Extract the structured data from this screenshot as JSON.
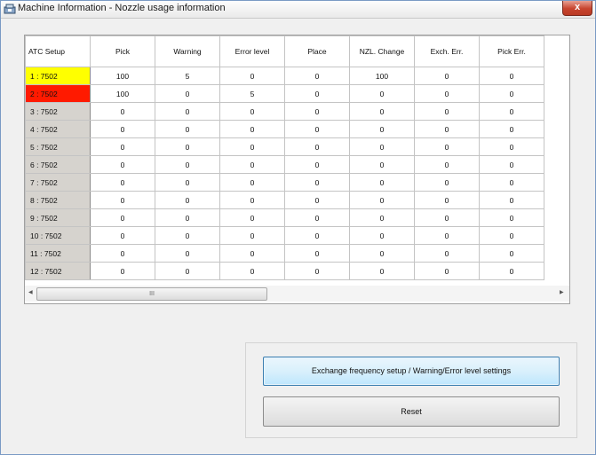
{
  "window": {
    "title": "Machine Information - Nozzle usage information",
    "close_label": "x"
  },
  "table": {
    "columns": [
      "ATC Setup",
      "Pick",
      "Warning",
      "Error level",
      "Place",
      "NZL. Change",
      "Exch. Err.",
      "Pick Err."
    ],
    "rows": [
      {
        "label": "1 :  7502",
        "status": "yellow",
        "values": [
          "100",
          "5",
          "0",
          "0",
          "100",
          "0",
          "0"
        ]
      },
      {
        "label": "2 :  7502",
        "status": "red",
        "values": [
          "100",
          "0",
          "5",
          "0",
          "0",
          "0",
          "0"
        ]
      },
      {
        "label": "3 :  7502",
        "status": "normal",
        "values": [
          "0",
          "0",
          "0",
          "0",
          "0",
          "0",
          "0"
        ]
      },
      {
        "label": "4 :  7502",
        "status": "normal",
        "values": [
          "0",
          "0",
          "0",
          "0",
          "0",
          "0",
          "0"
        ]
      },
      {
        "label": "5 :  7502",
        "status": "normal",
        "values": [
          "0",
          "0",
          "0",
          "0",
          "0",
          "0",
          "0"
        ]
      },
      {
        "label": "6 :  7502",
        "status": "normal",
        "values": [
          "0",
          "0",
          "0",
          "0",
          "0",
          "0",
          "0"
        ]
      },
      {
        "label": "7 :  7502",
        "status": "normal",
        "values": [
          "0",
          "0",
          "0",
          "0",
          "0",
          "0",
          "0"
        ]
      },
      {
        "label": "8 :  7502",
        "status": "normal",
        "values": [
          "0",
          "0",
          "0",
          "0",
          "0",
          "0",
          "0"
        ]
      },
      {
        "label": "9 :  7502",
        "status": "normal",
        "values": [
          "0",
          "0",
          "0",
          "0",
          "0",
          "0",
          "0"
        ]
      },
      {
        "label": "10 :  7502",
        "status": "normal",
        "values": [
          "0",
          "0",
          "0",
          "0",
          "0",
          "0",
          "0"
        ]
      },
      {
        "label": "11 :  7502",
        "status": "normal",
        "values": [
          "0",
          "0",
          "0",
          "0",
          "0",
          "0",
          "0"
        ]
      },
      {
        "label": "12 :  7502",
        "status": "normal",
        "values": [
          "0",
          "0",
          "0",
          "0",
          "0",
          "0",
          "0"
        ]
      }
    ]
  },
  "scrollbars": {
    "up_arrow_icon": "chevron-up-icon",
    "down_arrow_icon": "chevron-down-icon",
    "left_arrow_icon": "chevron-left-icon",
    "right_arrow_icon": "chevron-right-icon",
    "v_grip": "≡",
    "h_grip": "III"
  },
  "buttons": {
    "exchange_label": "Exchange frequency setup / Warning/Error level settings",
    "reset_label": "Reset"
  },
  "colors": {
    "warning_row": "#ffff00",
    "error_row": "#ff1a00",
    "focused_button_border": "#3c7fb1"
  }
}
